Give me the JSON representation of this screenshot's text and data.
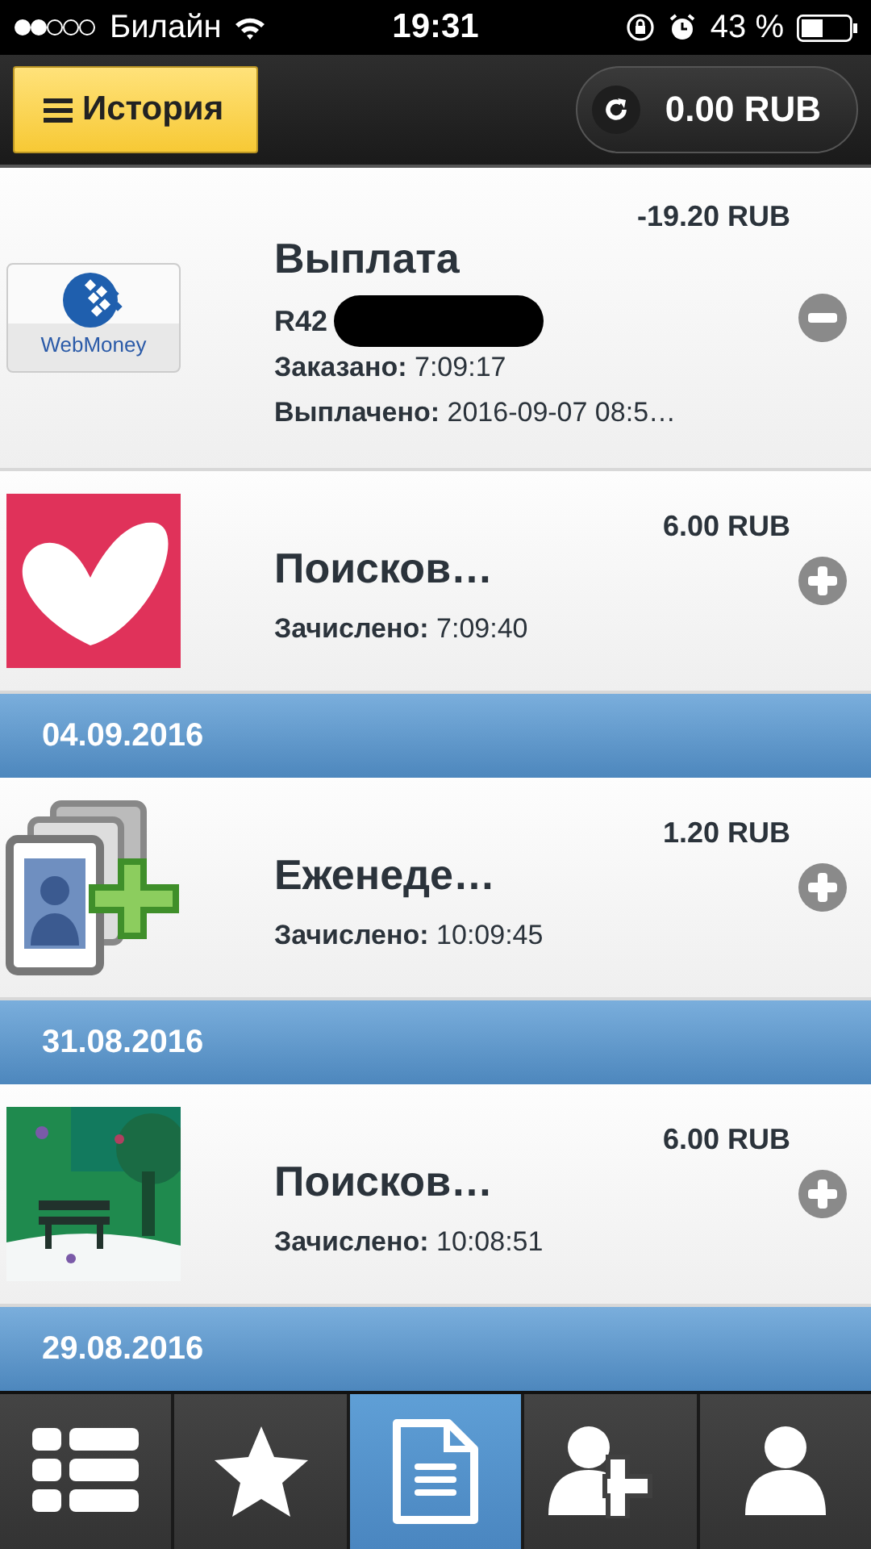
{
  "status_bar": {
    "carrier": "Билайн",
    "time": "19:31",
    "battery": "43 %"
  },
  "header": {
    "menu_label": "История",
    "balance": "0.00 RUB"
  },
  "feed": [
    {
      "kind": "payout",
      "logo_text": "WebMoney",
      "title": "Выплата",
      "amount": "-19.20 RUB",
      "account": "R42",
      "lines": [
        {
          "label": "Заказано:",
          "value": "7:09:17"
        },
        {
          "label": "Выплачено:",
          "value": "2016-09-07 08:5…"
        }
      ]
    },
    {
      "kind": "credit",
      "title": "Поисков…",
      "amount": "6.00 RUB",
      "lines": [
        {
          "label": "Зачислено:",
          "value": "7:09:40"
        }
      ]
    },
    {
      "kind": "date",
      "text": "04.09.2016"
    },
    {
      "kind": "credit",
      "title": "Еженеде…",
      "amount": "1.20 RUB",
      "lines": [
        {
          "label": "Зачислено:",
          "value": "10:09:45"
        }
      ]
    },
    {
      "kind": "date",
      "text": "31.08.2016"
    },
    {
      "kind": "credit",
      "title": "Поисков…",
      "amount": "6.00 RUB",
      "lines": [
        {
          "label": "Зачислено:",
          "value": "10:08:51"
        }
      ]
    },
    {
      "kind": "date",
      "text": "29.08.2016"
    }
  ],
  "tabs": [
    {
      "selected": false
    },
    {
      "selected": false
    },
    {
      "selected": true
    },
    {
      "selected": false
    },
    {
      "selected": false
    }
  ]
}
